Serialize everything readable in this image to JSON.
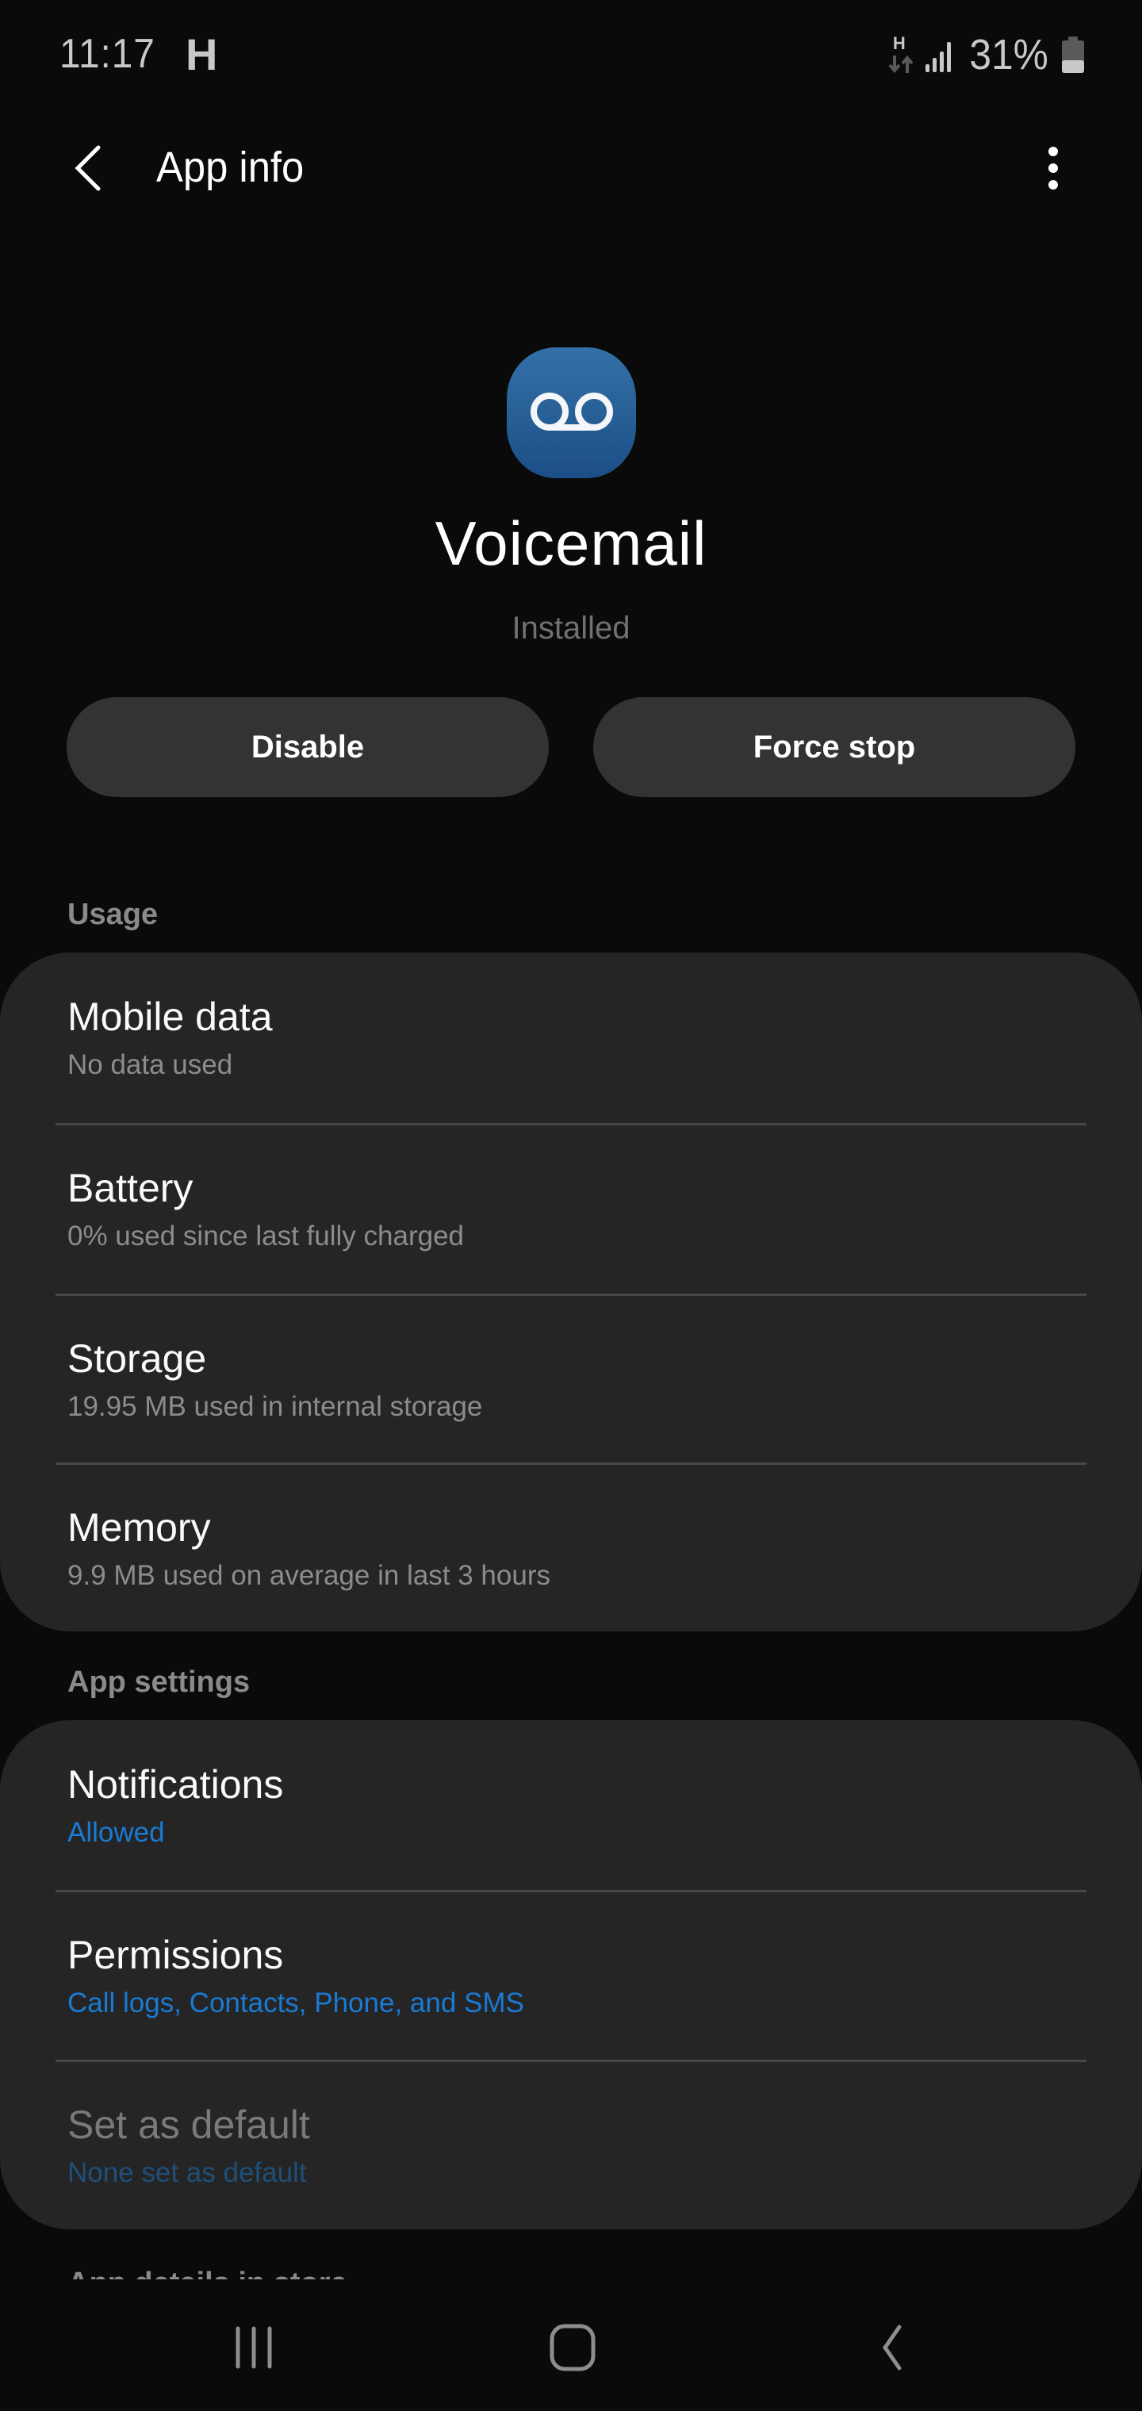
{
  "status_bar": {
    "time": "11:17",
    "network_type": "H",
    "data_indicator": "H",
    "battery_percent": "31%",
    "battery_level": 0.31,
    "icons": [
      "network-activity-icon",
      "signal-icon",
      "battery-icon"
    ]
  },
  "top_bar": {
    "title": "App info",
    "back_icon": "chevron-left-icon",
    "more_icon": "more-vertical-icon"
  },
  "app": {
    "name": "Voicemail",
    "status": "Installed",
    "icon": "voicemail-icon",
    "icon_colors": [
      "#3471a8",
      "#1c4e86"
    ]
  },
  "actions": {
    "disable_label": "Disable",
    "force_stop_label": "Force stop"
  },
  "sections": [
    {
      "header": "Usage",
      "items": [
        {
          "title": "Mobile data",
          "subtitle": "No data used"
        },
        {
          "title": "Battery",
          "subtitle": "0% used since last fully charged"
        },
        {
          "title": "Storage",
          "subtitle": "19.95 MB used in internal storage"
        },
        {
          "title": "Memory",
          "subtitle": "9.9 MB used on average in last 3 hours"
        }
      ]
    },
    {
      "header": "App settings",
      "items": [
        {
          "title": "Notifications",
          "subtitle": "Allowed",
          "subtitle_style": "accent"
        },
        {
          "title": "Permissions",
          "subtitle": "Call logs, Contacts, Phone, and SMS",
          "subtitle_style": "accent"
        },
        {
          "title": "Set as default",
          "subtitle": "None set as default",
          "disabled": true
        }
      ]
    },
    {
      "header": "App details in store",
      "partially_visible": true
    }
  ],
  "colors": {
    "accent": "#1a7ad4",
    "background": "#0a0a0a",
    "card": "#252525",
    "button": "#333333"
  },
  "nav_bar": {
    "recents_icon": "recents-icon",
    "home_icon": "home-icon",
    "back_icon": "back-icon"
  }
}
